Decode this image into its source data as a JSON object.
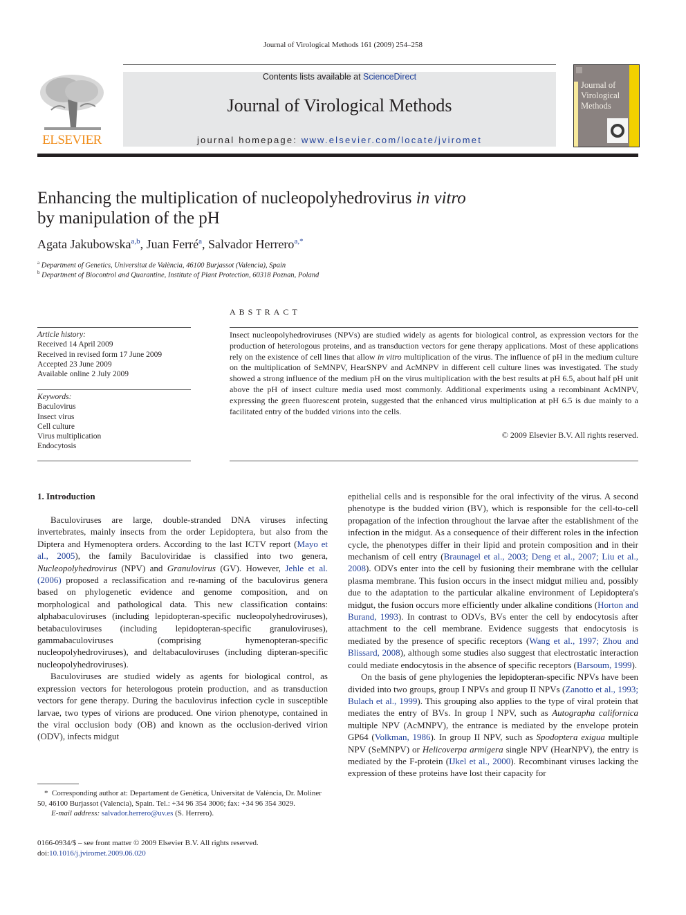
{
  "running_head": "Journal of Virological Methods 161 (2009) 254–258",
  "masthead": {
    "publisher_logo_text": "ELSEVIER",
    "contents_prefix": "Contents lists available at ",
    "contents_link": "ScienceDirect",
    "journal_title": "Journal of Virological Methods",
    "homepage_prefix": "journal homepage: ",
    "homepage_link": "www.elsevier.com/locate/jviromet",
    "cover_title_lines": [
      "Journal of",
      "Virological",
      "Methods"
    ],
    "colors": {
      "elsevier_orange": "#f08e1d",
      "link_blue": "#1f3f99",
      "cover_yellow": "#f2d100",
      "cover_gray": "#8a8280"
    }
  },
  "article": {
    "title_part1": "Enhancing the multiplication of nucleopolyhedrovirus ",
    "title_italic": "in vitro",
    "title_part2": "by manipulation of the pH",
    "authors": [
      {
        "name": "Agata Jakubowska",
        "sup": "a,b"
      },
      {
        "name": "Juan Ferré",
        "sup": "a"
      },
      {
        "name": "Salvador Herrero",
        "sup": "a,*"
      }
    ],
    "affiliations": [
      {
        "mark": "a",
        "text": "Department of Genetics, Universitat de València, 46100 Burjassot (Valencia), Spain"
      },
      {
        "mark": "b",
        "text": "Department of Biocontrol and Quarantine, Institute of Plant Protection, 60318 Poznan, Poland"
      }
    ]
  },
  "article_info": {
    "history_label": "Article history:",
    "history": [
      "Received 14 April 2009",
      "Received in revised form 17 June 2009",
      "Accepted 23 June 2009",
      "Available online 2 July 2009"
    ],
    "keywords_label": "Keywords:",
    "keywords": [
      "Baculovirus",
      "Insect virus",
      "Cell culture",
      "Virus multiplication",
      "Endocytosis"
    ]
  },
  "abstract": {
    "heading": "ABSTRACT",
    "text_1": "Insect nucleopolyhedroviruses (NPVs) are studied widely as agents for biological control, as expression vectors for the production of heterologous proteins, and as transduction vectors for gene therapy applications. Most of these applications rely on the existence of cell lines that allow ",
    "text_italic": "in vitro",
    "text_2": " multiplication of the virus. The influence of pH in the medium culture on the multiplication of SeMNPV, HearSNPV and AcMNPV in different cell culture lines was investigated. The study showed a strong influence of the medium pH on the virus multiplication with the best results at pH 6.5, about half pH unit above the pH of insect culture media used most commonly. Additional experiments using a recombinant AcMNPV, expressing the green fluorescent protein, suggested that the enhanced virus multiplication at pH 6.5 is due mainly to a facilitated entry of the budded virions into the cells.",
    "copyright": "© 2009 Elsevier B.V. All rights reserved."
  },
  "introduction": {
    "heading": "1.  Introduction",
    "left_p1": [
      {
        "t": "Baculoviruses are large, double-stranded DNA viruses infecting invertebrates, mainly insects from the order Lepidoptera, but also from the Diptera and Hymenoptera orders. According to the last ICTV report ("
      },
      {
        "c": "Mayo et al., 2005"
      },
      {
        "t": "), the family Baculoviridae is classified into two genera, "
      },
      {
        "i": "Nucleopolyhedrovirus"
      },
      {
        "t": " (NPV) and "
      },
      {
        "i": "Granulovirus"
      },
      {
        "t": " (GV). However, "
      },
      {
        "c": "Jehle et al. (2006)"
      },
      {
        "t": " proposed a reclassification and re-naming of the baculovirus genera based on phylogenetic evidence and genome composition, and on morphological and pathological data. This new classification contains: alphabaculoviruses (including lepidopteran-specific nucleopolyhedroviruses), betabaculoviruses (including lepidopteran-specific granuloviruses), gammabaculoviruses (comprising hymenopteran-specific nucleopolyhedroviruses), and deltabaculoviruses (including dipteran-specific nucleopolyhedroviruses)."
      }
    ],
    "left_p2": [
      {
        "t": "Baculoviruses are studied widely as agents for biological control, as expression vectors for heterologous protein production, and as transduction vectors for gene therapy. During the baculovirus infection cycle in susceptible larvae, two types of virions are produced. One virion phenotype, contained in the viral occlusion body (OB) and known as the occlusion-derived virion (ODV), infects midgut"
      }
    ],
    "right_p1": [
      {
        "t": "epithelial cells and is responsible for the oral infectivity of the virus. A second phenotype is the budded virion (BV), which is responsible for the cell-to-cell propagation of the infection throughout the larvae after the establishment of the infection in the midgut. As a consequence of their different roles in the infection cycle, the phenotypes differ in their lipid and protein composition and in their mechanism of cell entry ("
      },
      {
        "c": "Braunagel et al., 2003; Deng et al., 2007; Liu et al., 2008"
      },
      {
        "t": "). ODVs enter into the cell by fusioning their membrane with the cellular plasma membrane. This fusion occurs in the insect midgut milieu and, possibly due to the adaptation to the particular alkaline environment of Lepidoptera's midgut, the fusion occurs more efficiently under alkaline conditions ("
      },
      {
        "c": "Horton and Burand, 1993"
      },
      {
        "t": "). In contrast to ODVs, BVs enter the cell by endocytosis after attachment to the cell membrane. Evidence suggests that endocytosis is mediated by the presence of specific receptors ("
      },
      {
        "c": "Wang et al., 1997; Zhou and Blissard, 2008"
      },
      {
        "t": "), although some studies also suggest that electrostatic interaction could mediate endocytosis in the absence of specific receptors ("
      },
      {
        "c": "Barsoum, 1999"
      },
      {
        "t": ")."
      }
    ],
    "right_p2": [
      {
        "t": "On the basis of gene phylogenies the lepidopteran-specific NPVs have been divided into two groups, group I NPVs and group II NPVs ("
      },
      {
        "c": "Zanotto et al., 1993; Bulach et al., 1999"
      },
      {
        "t": "). This grouping also applies to the type of viral protein that mediates the entry of BVs. In group I NPV, such as "
      },
      {
        "i": "Autographa californica"
      },
      {
        "t": " multiple NPV (AcMNPV), the entrance is mediated by the envelope protein GP64 ("
      },
      {
        "c": "Volkman, 1986"
      },
      {
        "t": "). In group II NPV, such as "
      },
      {
        "i": "Spodoptera exigua"
      },
      {
        "t": " multiple NPV (SeMNPV) or "
      },
      {
        "i": "Helicoverpa armigera"
      },
      {
        "t": " single NPV (HearNPV), the entry is mediated by the F-protein ("
      },
      {
        "c": "IJkel et al., 2000"
      },
      {
        "t": "). Recombinant viruses lacking the expression of these proteins have lost their capacity for"
      }
    ]
  },
  "footnote": {
    "mark": "*",
    "text": "Corresponding author at: Departament de Genètica, Universitat de València, Dr. Moliner 50, 46100 Burjassot (Valencia), Spain. Tel.: +34 96 354 3006; fax: +34 96 354 3029.",
    "email_label": "E-mail address: ",
    "email": "salvador.herrero@uv.es",
    "email_suffix": " (S. Herrero)."
  },
  "front_matter": {
    "issn_line": "0166-0934/$ – see front matter © 2009 Elsevier B.V. All rights reserved.",
    "doi_label": "doi:",
    "doi": "10.1016/j.jviromet.2009.06.020"
  }
}
